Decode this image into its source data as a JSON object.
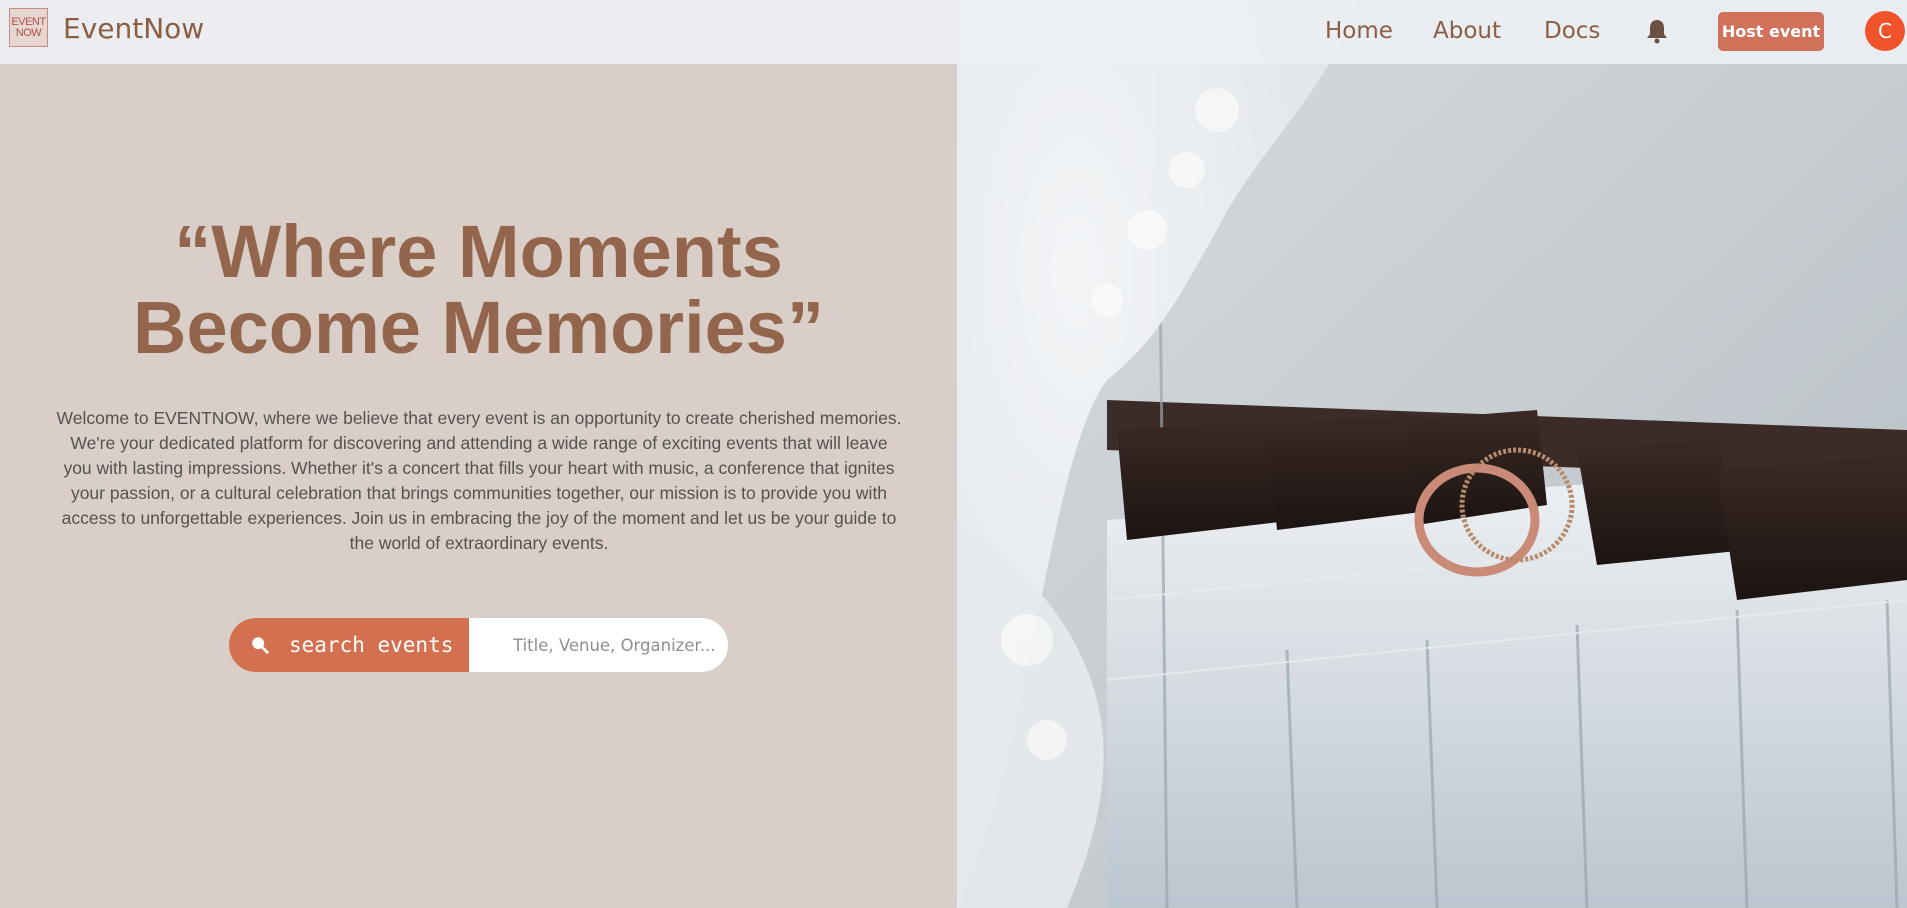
{
  "navbar": {
    "logo_line1": "EVENT",
    "logo_line2": "NOW",
    "brand": "EventNow",
    "links": [
      "Home",
      "About",
      "Docs"
    ],
    "bell_icon": "bell-icon",
    "host_button": "Host event",
    "avatar_initial": "C"
  },
  "hero": {
    "headline_line1": "“Where Moments",
    "headline_line2": "Become Memories”",
    "intro": "Welcome to EVENTNOW, where we believe that every event is an opportunity to create cherished memories. We're your dedicated platform for discovering and attending a wide range of exciting events that will leave you with lasting impressions. Whether it's a concert that fills your heart with music, a conference that ignites your passion, or a cultural celebration that brings communities together, our mission is to provide you with access to unforgettable experiences. Join us in embracing the joy of the moment and let us be your guide to the world of extraordinary events."
  },
  "search": {
    "button_label": "search events",
    "icon": "search-icon",
    "placeholder": "Title, Venue, Organizer..."
  },
  "colors": {
    "brand": "#8b5e43",
    "accent": "#d2704f",
    "panel_bg": "#d9cfc8",
    "avatar": "#f0522a"
  }
}
